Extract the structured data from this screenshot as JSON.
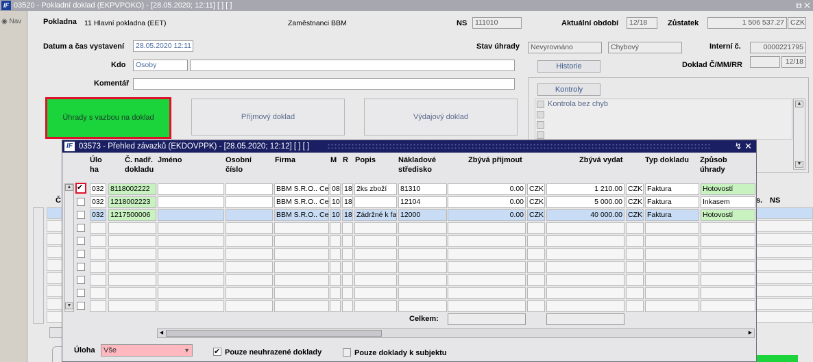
{
  "app": {
    "title": "03520 - Pokladní doklad (EKPVPOKO) - [28.05.2020; 12:11]  [ ]  [ ]",
    "logo": "IF",
    "nav_label": "Nav"
  },
  "header": {
    "pokladna_label": "Pokladna",
    "pokladna_value": "11 Hlavní pokladna (EET)",
    "zamestnanci": "Zaměstnanci BBM",
    "ns_label": "NS",
    "ns_value": "111010",
    "obdobi_label": "Aktuální období",
    "obdobi_value": "12/18",
    "zustatek_label": "Zůstatek",
    "zustatek_value": "1 506 537.27",
    "zustatek_mena": "CZK"
  },
  "form": {
    "datum_label": "Datum a čas vystavení",
    "datum_value": "28.05.2020 12:11",
    "kdo_label": "Kdo",
    "kdo_value": "Osoby",
    "kdo_value2": "",
    "komentar_label": "Komentář",
    "komentar_value": "",
    "stav_label": "Stav úhrady",
    "stav_value1": "Nevyrovnáno",
    "stav_value2": "Chybový",
    "historie_btn": "Historie",
    "interni_label": "Interní č.",
    "interni_value": "0000221795",
    "doklad_label": "Doklad Č/MM/RR",
    "doklad_value1": "",
    "doklad_value2": "12/18",
    "kontroly_btn": "Kontroly",
    "kontrola_label": "Kontrola bez chyb"
  },
  "actions": {
    "uhrady_btn": "Úhrady s vazbou na doklad",
    "prijmovy_btn": "Příjmový doklad",
    "vydajovy_btn": "Výdajový doklad"
  },
  "background_grid": {
    "col_c": "Č",
    "col_s": "s.",
    "col_ns": "NS"
  },
  "overlay": {
    "logo": "IF",
    "title": "03573 - Přehled závazků (EKDOVPPK) - [28.05.2020; 12:12]  [ ]  [ ]",
    "columns": {
      "uloha": "Úlo ha",
      "c_nadr": "Č. nadř. dokladu",
      "jmeno": "Jméno",
      "osobni": "Osobní číslo",
      "firma": "Firma",
      "m": "M",
      "r": "R",
      "popis": "Popis",
      "nakladove": "Nákladové středisko",
      "zbyva_prijmout": "Zbývá přijmout",
      "zbyva_vydat": "Zbývá vydat",
      "typ_dokladu": "Typ dokladu",
      "zpusob": "Způsob úhrady"
    },
    "rows": [
      {
        "checked": true,
        "uloha": "032",
        "c_nadr": "8118002222",
        "jmeno": "",
        "osobni": "",
        "firma": "BBM S.R.O.. Ce",
        "m": "08",
        "r": "18",
        "popis": "2ks zboží",
        "nakladove": "81310",
        "zbyva_prijmout": "0.00",
        "mena1": "CZK",
        "zbyva_vydat": "1 210.00",
        "mena2": "CZK",
        "typ": "Faktura",
        "zpusob": "Hotovostí"
      },
      {
        "checked": false,
        "uloha": "032",
        "c_nadr": "1218002223",
        "jmeno": "",
        "osobni": "",
        "firma": "BBM S.R.O.. Ce",
        "m": "10",
        "r": "18",
        "popis": "",
        "nakladove": "12104",
        "zbyva_prijmout": "0.00",
        "mena1": "CZK",
        "zbyva_vydat": "5 000.00",
        "mena2": "CZK",
        "typ": "Faktura",
        "zpusob": "Inkasem"
      },
      {
        "checked": false,
        "uloha": "032",
        "c_nadr": "1217500006",
        "jmeno": "",
        "osobni": "",
        "firma": "BBM S.R.O.. Ce",
        "m": "10",
        "r": "18",
        "popis": "Zádržné k fa",
        "nakladove": "12000",
        "zbyva_prijmout": "0.00",
        "mena1": "CZK",
        "zbyva_vydat": "40 000.00",
        "mena2": "CZK",
        "typ": "Faktura",
        "zpusob": "Hotovostí"
      }
    ],
    "celkem_label": "Celkem:",
    "uloha_label": "Úloha",
    "uloha_value": "Vše",
    "opt1_label": "Pouze neuhrazené doklady",
    "opt2_label": "Pouze doklady k subjektu"
  }
}
